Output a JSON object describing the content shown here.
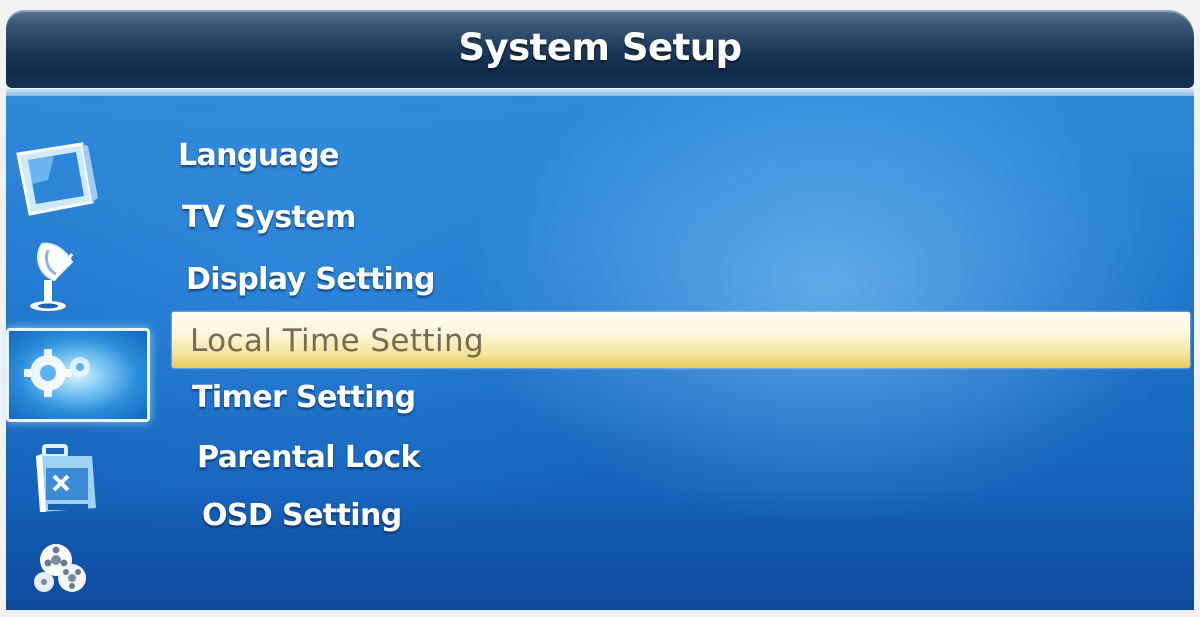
{
  "window": {
    "title": "System Setup"
  },
  "sidebar": {
    "icons": [
      {
        "name": "tv-icon"
      },
      {
        "name": "satellite-dish-icon"
      },
      {
        "name": "gear-icon",
        "selected": true
      },
      {
        "name": "toolbox-icon"
      },
      {
        "name": "film-reel-icon"
      }
    ]
  },
  "menu": {
    "items": [
      {
        "label": "Language"
      },
      {
        "label": "TV System"
      },
      {
        "label": "Display Setting"
      },
      {
        "label": "Local Time Setting",
        "selected": true
      },
      {
        "label": "Timer Setting"
      },
      {
        "label": "Parental Lock"
      },
      {
        "label": "OSD Setting"
      }
    ]
  },
  "colors": {
    "panel_blue": "#1f74cb",
    "titlebar_navy": "#1d3a5a",
    "highlight_cream": "#fbf6da",
    "highlight_gold": "#e8c85c",
    "selected_text": "#7a6a55"
  }
}
